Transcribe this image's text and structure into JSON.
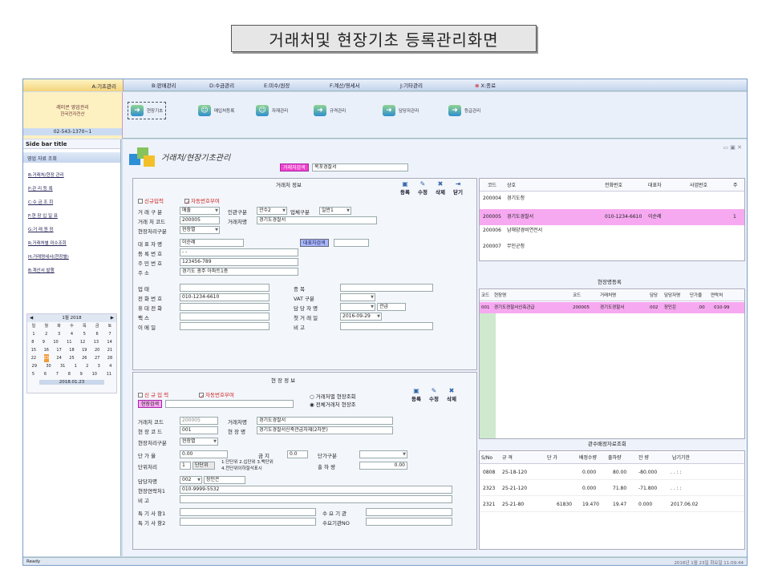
{
  "page_title": "거래처및 현장기초 등록관리화면",
  "menu": {
    "items": [
      "A:기초관리",
      "B:판매관리",
      "D:수금관리",
      "E:미수/원장",
      "F:계산/영세서",
      "J:기타관리",
      "X:종료"
    ]
  },
  "company": {
    "name": "레미콘 영업관리",
    "sub": "한국전자전산",
    "phone": "02-543-1370~1"
  },
  "ribbon": {
    "buttons": [
      "현장기초",
      "매입처등록",
      "자재관리",
      "규격관리",
      "담당자관리",
      "등급관리"
    ]
  },
  "sidebar": {
    "title": "Side bar title",
    "section": "영업 자료 조회",
    "items": [
      "B:거래처/현장 관리",
      "P:관 리 등 록",
      "C:수 금 조 회",
      "F:현 장 입 일 표",
      "G:거 래 원 장",
      "R:거래처별 미수조회",
      "H:거래명세서(현장별)",
      "B:계산서 발행"
    ],
    "calendar": {
      "header": "1월 2018",
      "weekdays": [
        "일",
        "월",
        "화",
        "수",
        "목",
        "금",
        "토"
      ],
      "rows": [
        [
          "1",
          "2",
          "3",
          "4",
          "5",
          "6",
          "7"
        ],
        [
          "8",
          "9",
          "10",
          "11",
          "12",
          "13",
          "14"
        ],
        [
          "15",
          "16",
          "17",
          "18",
          "19",
          "20",
          "21"
        ],
        [
          "22",
          "23",
          "24",
          "25",
          "26",
          "27",
          "28"
        ],
        [
          "29",
          "30",
          "31",
          "1",
          "2",
          "3",
          "4"
        ],
        [
          "5",
          "6",
          "7",
          "8",
          "9",
          "10",
          "11"
        ]
      ],
      "footer": "2018.01.23"
    }
  },
  "form": {
    "title": "거래처/현장기초관리",
    "search_btn": "거래처검색",
    "search_value": "목포경찰서",
    "vendor": {
      "section": "거래처 정보",
      "new_label": "신규입력",
      "biz_check_label": "자동번호부여",
      "tools": [
        "등록",
        "수정",
        "삭제",
        "닫기"
      ],
      "type_label": "거 래 구 분",
      "type_value": "매출",
      "local_label": "인관구분",
      "local_value": "관수2",
      "tax_label": "업체구분",
      "tax_value": "일반1",
      "code_label": "거래 처 코드",
      "code_value": "200005",
      "name_label": "거래처명",
      "name_value": "경기도경찰서",
      "site_label": "현장처리구분",
      "site_value": "현장별",
      "rep_label": "대 표 자 명",
      "rep_value": "이순례",
      "rep_search": "대표자검색",
      "reg_label": "등 록 번 호",
      "reg_value": "- -",
      "resid_label": "주 민 번 호",
      "resid_value": "123456-789",
      "addr_label": "주 소",
      "addr_value": "경기도 광주 아파트1층",
      "biz_label": "업 태",
      "item_label": "종 목",
      "tel_label": "전 화 번 호",
      "tel_value": "010-1234-6610",
      "vat_label": "VAT 구분",
      "mobile_label": "휴 대 전 화",
      "manager_label": "담 당 자 명",
      "manager_value": "관급",
      "fax_label": "팩 스",
      "first_date_label": "첫 거 래 일",
      "first_date_value": "2016-09-29",
      "email_label": "이 메 일",
      "note_label": "비 고"
    },
    "site": {
      "section": "현 장 정 보",
      "new_label": "신 규 입 력",
      "auto_label": "자동번호부여",
      "radio1": "거래처별 현장조회",
      "radio2": "전체거래처 현장조",
      "tools": [
        "등록",
        "수정",
        "삭제"
      ],
      "search_btn": "현장검색",
      "vcode_label": "거래처 코드",
      "vcode_value": "200005",
      "vname_label": "거래처명",
      "vname_value": "경기도경찰서",
      "scode_label": "현 장 코 드",
      "scode_value": "001",
      "sname_label": "현 장 명",
      "sname_value": "경기도경찰서신축관급자재(2차분)",
      "site_proc_label": "현장처리구분",
      "site_proc_value": "현장별",
      "price_label": "단 가 율",
      "price_value": "0.00",
      "pay_label": "금 지",
      "pay_value": "0.0",
      "price_type_label": "단가구분",
      "unit_label": "단위처리",
      "unit_value": "1",
      "unit_btn": "단단위",
      "unit_desc": "1.단단위 2.십단위 3.백단위",
      "unit_desc2": "4.천단위이하절삭표시",
      "out_label": "출 하 량",
      "out_value": "0.00",
      "person_label": "담당자명",
      "person_code": "002",
      "person_name": "장민은",
      "contact_label": "현장연락처1",
      "contact_value": "010-9999-5532",
      "note_label": "비 고",
      "special1_label": "특 기 사 항1",
      "special2_label": "특 기 사 항2",
      "demand_label": "수 요 기 관",
      "demand_no_label": "수요기관NO"
    }
  },
  "vendor_grid": {
    "headers": [
      "코드",
      "상호",
      "전화번호",
      "대표자",
      "사업번호",
      "주"
    ],
    "rows": [
      [
        "200004",
        "경기도청",
        "",
        "",
        ""
      ],
      [
        "200005",
        "경기도경찰서",
        "010-1234-6610",
        "이순례",
        "1"
      ],
      [
        "200006",
        "남해양경비연전서",
        "",
        "",
        ""
      ],
      [
        "200007",
        "무인군청",
        "",
        "",
        ""
      ]
    ]
  },
  "site_grid": {
    "title": "현장명등록",
    "headers": [
      "코드",
      "현장명",
      "코드",
      "거래처명",
      "담당",
      "담당자명",
      "단가율",
      "연락처"
    ],
    "rows": [
      [
        "001",
        "경기도경찰서신축관급",
        "200005",
        "경기도경찰서",
        "002",
        "장민은",
        ".00",
        "010-99"
      ]
    ]
  },
  "detail_grid": {
    "title": "관수배정자료조회",
    "headers": [
      "S/No",
      "규 격",
      "단 가",
      "배정수량",
      "출하량",
      "잔 량",
      "납기기한"
    ],
    "rows": [
      [
        "0808",
        "25-18-120",
        "",
        "0.000",
        "80.00",
        "-80.000",
        ". . : :"
      ],
      [
        "2323",
        "25-21-120",
        "",
        "0.000",
        "71.80",
        "-71.800",
        ". . : :"
      ],
      [
        "2321",
        "25-21-80",
        "61830",
        "19.470",
        "19.47",
        "0.000",
        "2017.06.02"
      ]
    ]
  },
  "status": {
    "left": "Ready",
    "right": "2018년 1월 23일 화요일 11:09:44"
  }
}
